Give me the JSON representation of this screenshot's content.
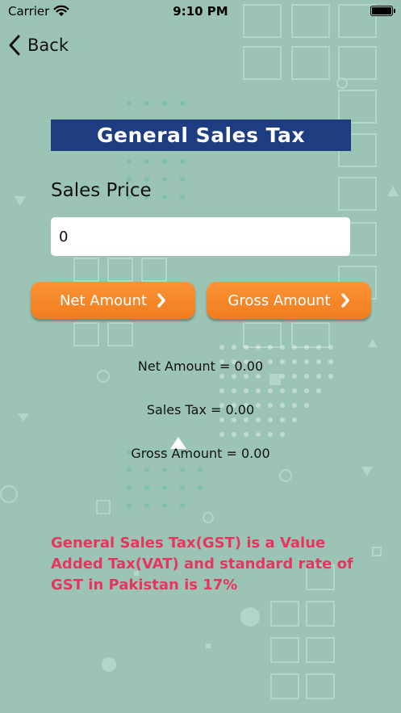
{
  "status_bar": {
    "carrier": "Carrier",
    "time": "9:10 PM"
  },
  "nav": {
    "back_label": "Back"
  },
  "header": {
    "title": "General Sales Tax"
  },
  "form": {
    "sales_price_label": "Sales Price",
    "sales_price_value": "0"
  },
  "buttons": {
    "net_amount_label": "Net Amount",
    "gross_amount_label": "Gross Amount"
  },
  "results": {
    "net_amount": "Net Amount = 0.00",
    "sales_tax": "Sales Tax = 0.00",
    "gross_amount": "Gross Amount = 0.00"
  },
  "info": {
    "text": "General Sales Tax(GST) is a Value Added Tax(VAT) and standard rate of GST in Pakistan is 17%"
  },
  "theme": {
    "background": "#9cc4b4",
    "title_bar": "#1d3d80",
    "button": "#f7891f",
    "info_text": "#e83560"
  }
}
